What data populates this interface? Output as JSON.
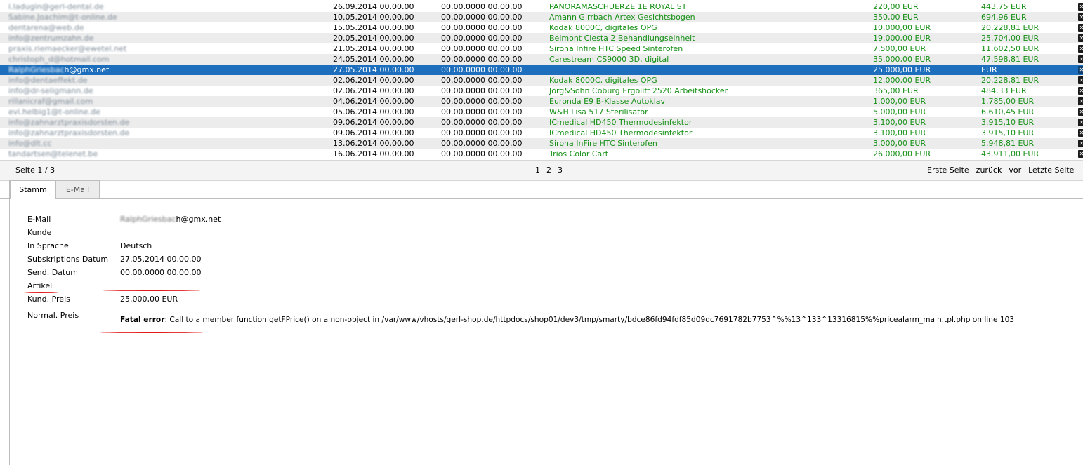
{
  "list": {
    "rows": [
      {
        "email": "i.ladugin@gerl-dental.de",
        "sub": "26.09.2014 00.00.00",
        "send": "00.00.0000 00.00.00",
        "article": "PANORAMASCHUERZE 1E ROYAL ST",
        "price": "220,00 EUR",
        "kprice": "443,75 EUR"
      },
      {
        "email": "Sabine.Joachim@t-online.de",
        "sub": "10.05.2014 00.00.00",
        "send": "00.00.0000 00.00.00",
        "article": "Amann Girrbach Artex Gesichtsbogen",
        "price": "350,00 EUR",
        "kprice": "694,96 EUR"
      },
      {
        "email": "dentarena@web.de",
        "sub": "15.05.2014 00.00.00",
        "send": "00.00.0000 00.00.00",
        "article": "Kodak 8000C, digitales OPG",
        "price": "10.000,00 EUR",
        "kprice": "20.228,81 EUR"
      },
      {
        "email": "info@zentrumzahn.de",
        "sub": "20.05.2014 00.00.00",
        "send": "00.00.0000 00.00.00",
        "article": "Belmont Clesta 2 Behandlungseinheit",
        "price": "19.000,00 EUR",
        "kprice": "25.704,00 EUR"
      },
      {
        "email": "praxis.riemaecker@ewetel.net",
        "sub": "21.05.2014 00.00.00",
        "send": "00.00.0000 00.00.00",
        "article": "Sirona Infire HTC Speed Sinterofen",
        "price": "7.500,00 EUR",
        "kprice": "11.602,50 EUR"
      },
      {
        "email": "christoph_d@hotmail.com",
        "sub": "24.05.2014 00.00.00",
        "send": "00.00.0000 00.00.00",
        "article": "Carestream CS9000 3D, digital",
        "price": "35.000,00 EUR",
        "kprice": "47.598,81 EUR"
      },
      {
        "email_blur": "RalphGriesbac",
        "email_vis": "h@gmx.net",
        "sub": "27.05.2014 00.00.00",
        "send": "00.00.0000 00.00.00",
        "article": "",
        "price": "25.000,00 EUR",
        "kprice": "EUR",
        "selected": true
      },
      {
        "email": "info@dentaeffekt.de",
        "sub": "02.06.2014 00.00.00",
        "send": "00.00.0000 00.00.00",
        "article": "Kodak 8000C, digitales OPG",
        "price": "12.000,00 EUR",
        "kprice": "20.228,81 EUR"
      },
      {
        "email": "info@dr-seligmann.de",
        "sub": "02.06.2014 00.00.00",
        "send": "00.00.0000 00.00.00",
        "article": "Jörg&Sohn Coburg Ergolift 2520 Arbeitshocker",
        "price": "365,00 EUR",
        "kprice": "484,33 EUR"
      },
      {
        "email": "rillanicraf@gmail.com",
        "sub": "04.06.2014 00.00.00",
        "send": "00.00.0000 00.00.00",
        "article": "Euronda E9 B-Klasse Autoklav",
        "price": "1.000,00 EUR",
        "kprice": "1.785,00 EUR"
      },
      {
        "email": "evi.helbig1@t-online.de",
        "sub": "05.06.2014 00.00.00",
        "send": "00.00.0000 00.00.00",
        "article": "W&H Lisa 517 Sterilisator",
        "price": "5.000,00 EUR",
        "kprice": "6.610,45 EUR"
      },
      {
        "email": "info@zahnarztpraxisdorsten.de",
        "sub": "09.06.2014 00.00.00",
        "send": "00.00.0000 00.00.00",
        "article": "ICmedical HD450 Thermodesinfektor",
        "price": "3.100,00 EUR",
        "kprice": "3.915,10 EUR"
      },
      {
        "email": "info@zahnarztpraxisdorsten.de",
        "sub": "09.06.2014 00.00.00",
        "send": "00.00.0000 00.00.00",
        "article": "ICmedical HD450 Thermodesinfektor",
        "price": "3.100,00 EUR",
        "kprice": "3.915,10 EUR"
      },
      {
        "email": "info@dlt.cc",
        "sub": "13.06.2014 00.00.00",
        "send": "00.00.0000 00.00.00",
        "article": "Sirona InFire HTC Sinterofen",
        "price": "3.000,00 EUR",
        "kprice": "5.948,81 EUR"
      },
      {
        "email": "tandartsen@telenet.be",
        "sub": "16.06.2014 00.00.00",
        "send": "00.00.0000 00.00.00",
        "article": "Trios Color Cart",
        "price": "26.000,00 EUR",
        "kprice": "43.911,00 EUR"
      }
    ]
  },
  "pager": {
    "page_label": "Seite 1 / 3",
    "pages": [
      "1",
      "2",
      "3"
    ],
    "first": "Erste Seite",
    "prev": "zurück",
    "next": "vor",
    "last": "Letzte Seite"
  },
  "tabs": {
    "stamm": "Stamm",
    "email": "E-Mail"
  },
  "detail": {
    "email_label": "E-Mail",
    "email_blur": "RalphGriesbac",
    "email_vis": "h@gmx.net",
    "kunde_label": "Kunde",
    "sprache_label": "In Sprache",
    "sprache_value": "Deutsch",
    "subdate_label": "Subskriptions Datum",
    "subdate_value": "27.05.2014 00.00.00",
    "senddate_label": "Send. Datum",
    "senddate_value": "00.00.0000 00.00.00",
    "artikel_label": "Artikel",
    "kprice_label": "Kund. Preis",
    "kprice_value": "25.000,00 EUR",
    "nprice_label": "Normal. Preis",
    "error_prefix": "Fatal error",
    "error_text": ": Call to a member function getFPrice() on a non-object in /var/www/vhosts/gerl-shop.de/httpdocs/shop01/dev3/tmp/smarty/bdce86fd94fdf85d09dc7691782b7753^%%13^133^13316815%%pricealarm_main.tpl.php on line 103"
  },
  "colors": {
    "selected_row": "#1d6fbd",
    "article_green": "#159015",
    "annotation_red": "#e21a1a"
  }
}
